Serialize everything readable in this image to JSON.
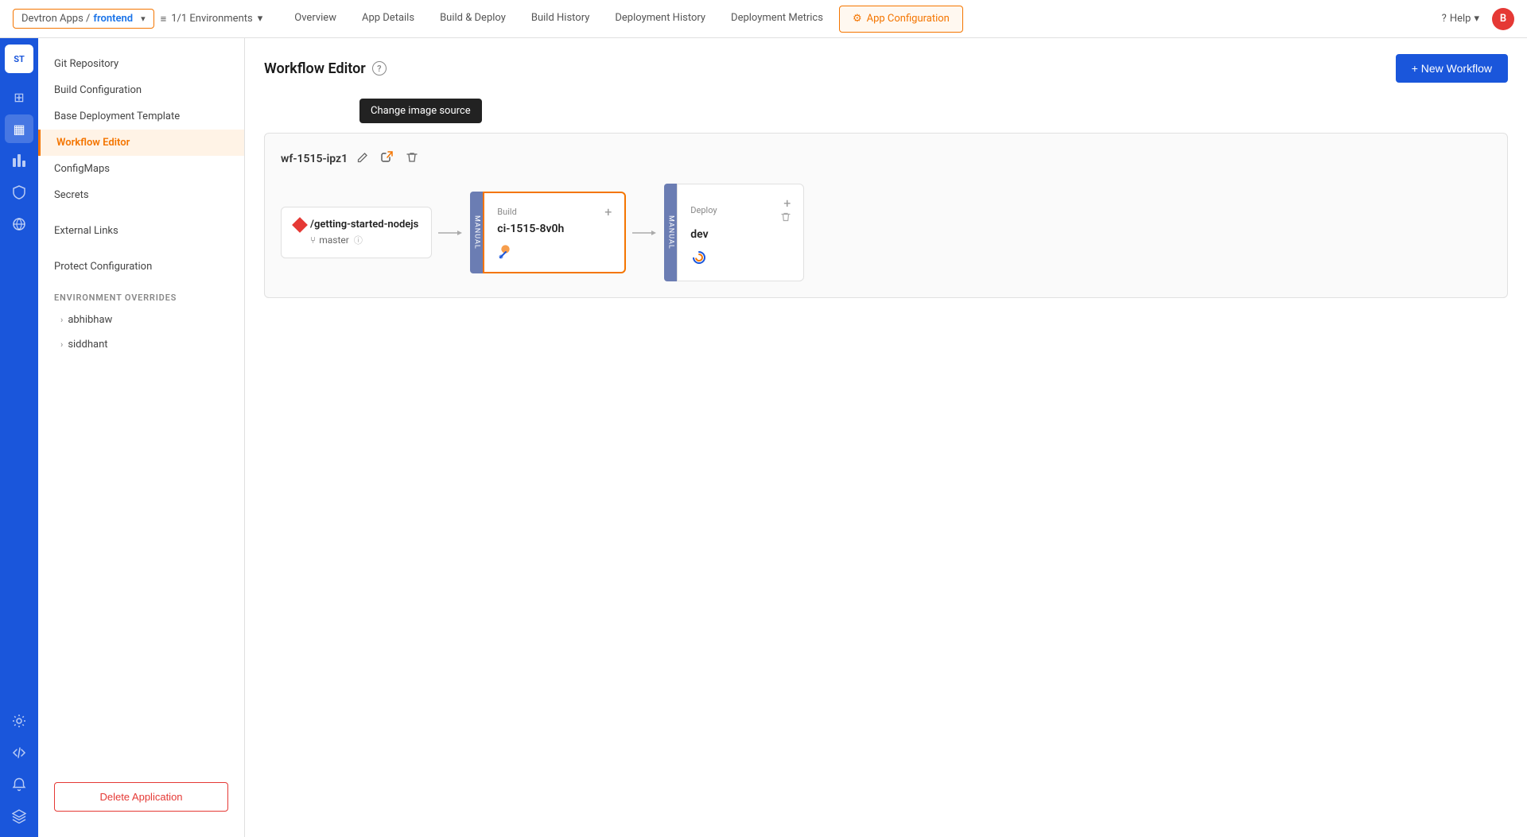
{
  "appLogo": "ST",
  "breadcrumb": {
    "prefix": "Devtron Apps /",
    "appName": "frontend",
    "chevron": "▾"
  },
  "envSelector": {
    "icon": "≡",
    "label": "1/1 Environments",
    "chevron": "▾"
  },
  "topNav": {
    "tabs": [
      {
        "id": "overview",
        "label": "Overview",
        "active": false
      },
      {
        "id": "app-details",
        "label": "App Details",
        "active": false
      },
      {
        "id": "build-deploy",
        "label": "Build & Deploy",
        "active": false
      },
      {
        "id": "build-history",
        "label": "Build History",
        "active": false
      },
      {
        "id": "deployment-history",
        "label": "Deployment History",
        "active": false
      },
      {
        "id": "deployment-metrics",
        "label": "Deployment Metrics",
        "active": false
      },
      {
        "id": "app-configuration",
        "label": "App Configuration",
        "active": true
      }
    ]
  },
  "help": {
    "label": "Help",
    "chevron": "▾"
  },
  "avatar": "B",
  "sidebarIcons": [
    {
      "id": "dashboard",
      "symbol": "⊞",
      "active": false
    },
    {
      "id": "apps",
      "symbol": "▦",
      "active": true
    },
    {
      "id": "charts",
      "symbol": "▤",
      "active": false
    },
    {
      "id": "security",
      "symbol": "⬡",
      "active": false
    },
    {
      "id": "bulk-edit",
      "symbol": "⚙",
      "active": false
    },
    {
      "id": "global-config",
      "symbol": "◎",
      "active": false
    },
    {
      "id": "code",
      "symbol": "</>",
      "active": false
    },
    {
      "id": "notification",
      "symbol": "🔔",
      "active": false
    },
    {
      "id": "layers",
      "symbol": "⬛",
      "active": false
    }
  ],
  "leftNav": {
    "items": [
      {
        "id": "git-repository",
        "label": "Git Repository",
        "active": false
      },
      {
        "id": "build-configuration",
        "label": "Build Configuration",
        "active": false
      },
      {
        "id": "base-deployment-template",
        "label": "Base Deployment Template",
        "active": false
      },
      {
        "id": "workflow-editor",
        "label": "Workflow Editor",
        "active": true
      },
      {
        "id": "configmaps",
        "label": "ConfigMaps",
        "active": false
      },
      {
        "id": "secrets",
        "label": "Secrets",
        "active": false
      },
      {
        "id": "external-links",
        "label": "External Links",
        "active": false
      },
      {
        "id": "protect-configuration",
        "label": "Protect Configuration",
        "active": false
      }
    ],
    "envOverridesSection": "ENVIRONMENT OVERRIDES",
    "envItems": [
      {
        "id": "abhibhaw",
        "label": "abhibhaw"
      },
      {
        "id": "siddhant",
        "label": "siddhant"
      }
    ],
    "deleteBtn": "Delete Application"
  },
  "workflowEditor": {
    "title": "Workflow Editor",
    "helpCircle": "?",
    "newWorkflowBtn": "+ New Workflow",
    "tooltip": "Change image source",
    "workflow": {
      "id": "wf-1515-ipz1",
      "editIcon": "✎",
      "linkIcon": "⟳",
      "deleteIcon": "🗑"
    },
    "pipeline": {
      "source": {
        "name": "/getting-started-nodejs",
        "branch": "master",
        "branchIcon": "⑂",
        "helpIcon": "ⓘ"
      },
      "build": {
        "manualLabel": "MANUAL",
        "label": "Build",
        "name": "ci-1515-8v0h",
        "addIcon": "+",
        "toolsIcon": "🔧"
      },
      "deploy": {
        "manualLabel": "MANUAL",
        "label": "Deploy",
        "name": "dev",
        "addIcon": "+",
        "deleteIcon": "🗑"
      }
    }
  }
}
